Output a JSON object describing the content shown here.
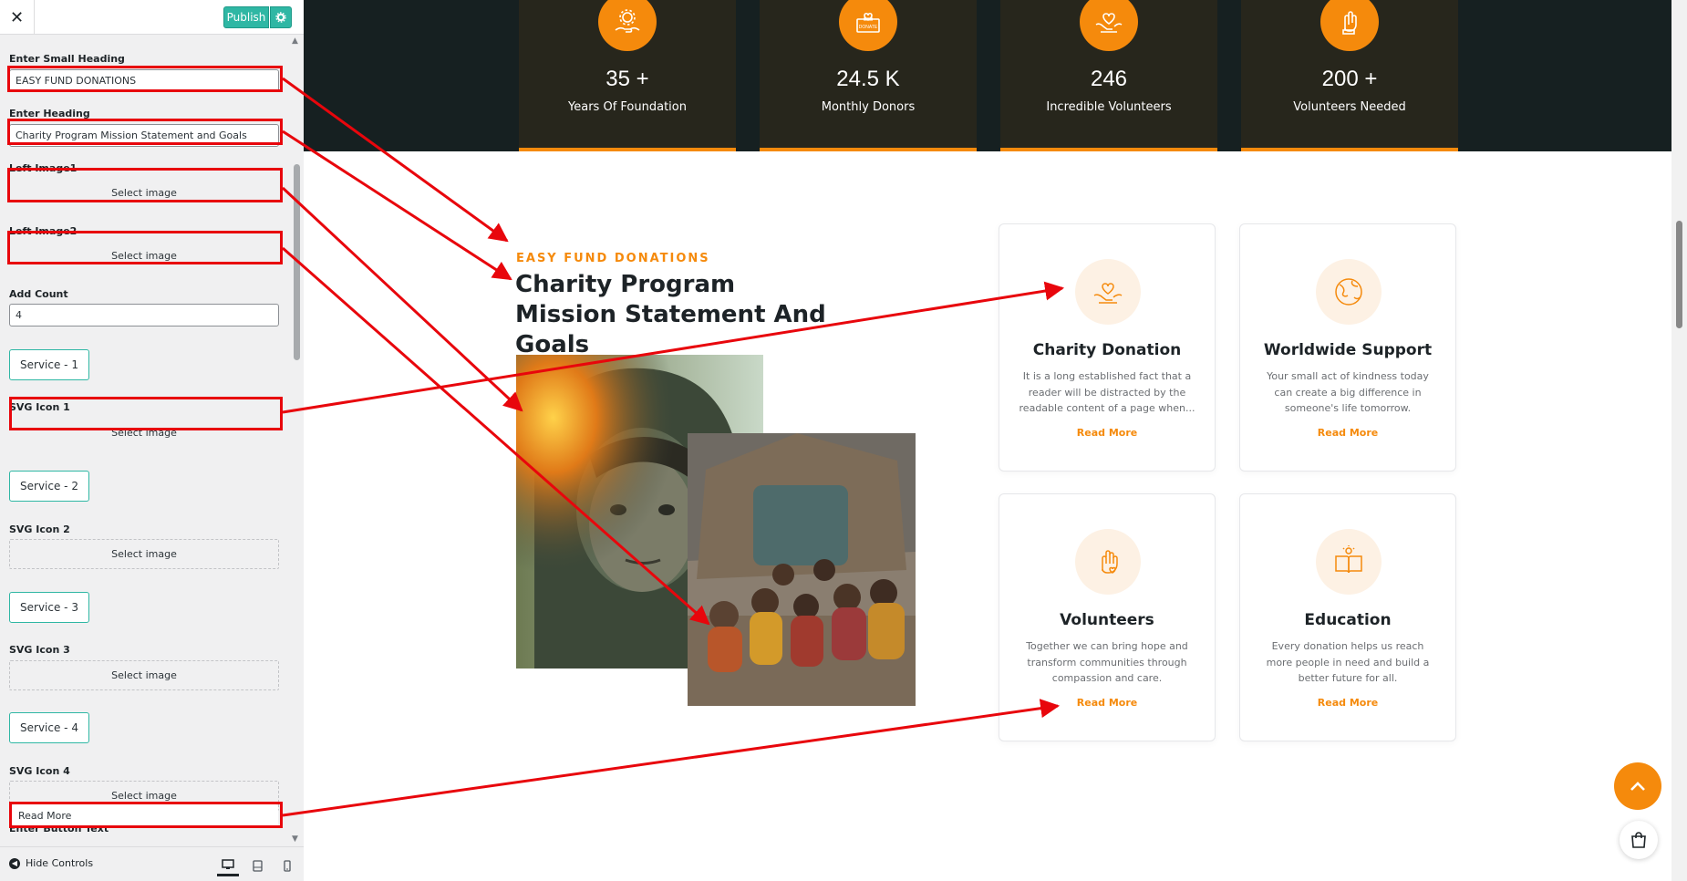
{
  "sidebar": {
    "close_symbol": "✕",
    "publish_label": "Publish",
    "gear_icon": "gear-icon",
    "fields": {
      "small_heading_label": "Enter Small Heading",
      "small_heading_value": "EASY FUND DONATIONS",
      "heading_label": "Enter Heading",
      "heading_value": "Charity Program Mission Statement and Goals",
      "left_image1_label": "Left Image1",
      "left_image2_label": "Left Image2",
      "select_image": "Select image",
      "add_count_label": "Add Count",
      "add_count_value": "4",
      "services": [
        {
          "button": "Service - 1",
          "icon_label": "SVG Icon 1"
        },
        {
          "button": "Service - 2",
          "icon_label": "SVG Icon 2"
        },
        {
          "button": "Service - 3",
          "icon_label": "SVG Icon 3"
        },
        {
          "button": "Service - 4",
          "icon_label": "SVG Icon 4"
        }
      ],
      "button_text_label": "Enter Button Text",
      "button_text_value": "Read More"
    },
    "footer": {
      "hide_controls": "Hide Controls",
      "devices": [
        "desktop-icon",
        "tablet-icon",
        "mobile-icon"
      ]
    }
  },
  "preview": {
    "stats": [
      {
        "number": "35 +",
        "label": "Years Of Foundation",
        "icon": "hands-gear-icon"
      },
      {
        "number": "24.5 K",
        "label": "Monthly Donors",
        "icon": "donate-box-icon"
      },
      {
        "number": "246",
        "label": "Incredible Volunteers",
        "icon": "heart-hands-icon"
      },
      {
        "number": "200 +",
        "label": "Volunteers Needed",
        "icon": "volunteer-hand-icon"
      }
    ],
    "small_heading": "EASY FUND DONATIONS",
    "heading": "Charity Program Mission Statement And Goals",
    "services": [
      {
        "title": "Charity Donation",
        "text": "It is a long established fact that a reader will be distracted by the readable content of a page when...",
        "link": "Read More",
        "icon": "charity-hands-icon"
      },
      {
        "title": "Worldwide Support",
        "text": "Your small act of kindness today can create a big difference in someone's life tomorrow.",
        "link": "Read More",
        "icon": "globe-icon"
      },
      {
        "title": "Volunteers",
        "text": "Together we can bring hope and transform communities through compassion and care.",
        "link": "Read More",
        "icon": "raised-hand-heart-icon"
      },
      {
        "title": "Education",
        "text": "Every donation helps us reach more people in need and build a better future for all.",
        "link": "Read More",
        "icon": "open-book-icon"
      }
    ]
  },
  "colors": {
    "accent": "#f58a0c",
    "dark_band": "#162021",
    "publish": "#2fb7a4",
    "annotation_red": "#e8060c"
  }
}
